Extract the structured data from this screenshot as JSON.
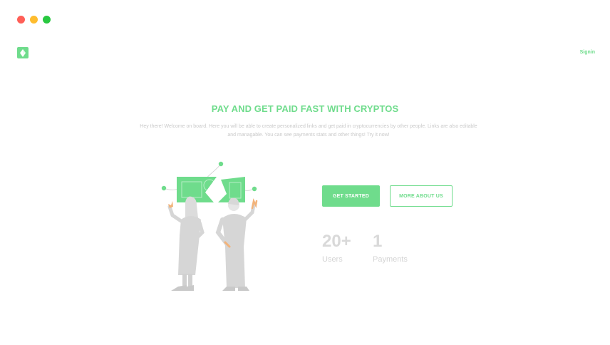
{
  "window": {
    "controls": [
      "close",
      "minimize",
      "maximize"
    ]
  },
  "header": {
    "logo_icon": "ethereum-diamond-icon",
    "signin_label": "Signin"
  },
  "hero": {
    "title": "PAY AND GET PAID FAST WITH CRYPTOS",
    "description": "Hey there! Welcome on board. Here you will be able to create personalized links and get paid in cryptocurrencies by other people. Links are also editable and managable. You can see payments stats and other things! Try it now!"
  },
  "actions": {
    "get_started_label": "GET STARTED",
    "more_about_label": "MORE ABOUT US"
  },
  "stats": {
    "users": {
      "value": "20+",
      "label": "Users"
    },
    "payments": {
      "value": "1",
      "label": "Payments"
    }
  },
  "colors": {
    "accent": "#6fdc8c",
    "muted_text": "#c9c9c9",
    "stat_text": "#d9d9d9"
  },
  "illustration": "two-people-holding-torn-banknote"
}
